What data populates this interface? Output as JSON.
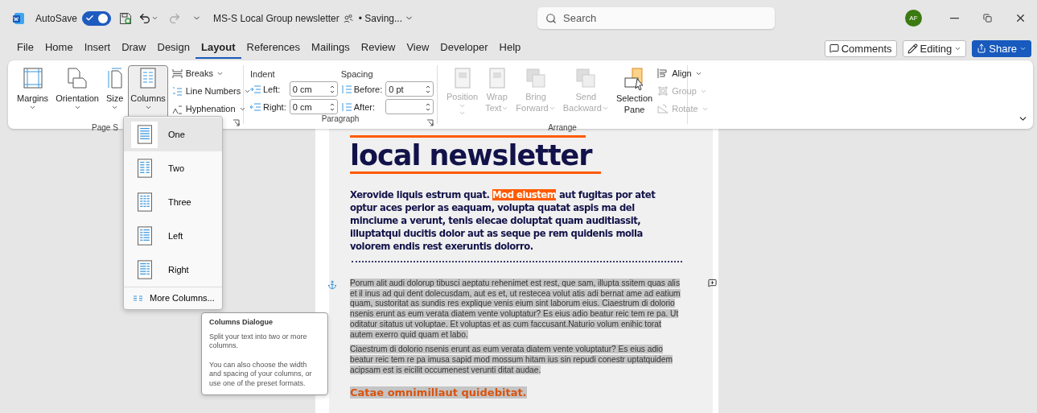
{
  "title_bar": {
    "autosave_label": "AutoSave",
    "autosave_on": true,
    "doc_title": "MS-S Local Group newsletter",
    "status": "• Saving...",
    "search": {
      "placeholder": "Search"
    },
    "avatar": "AF"
  },
  "menu_tabs": [
    {
      "label": "File",
      "selected": false
    },
    {
      "label": "Home",
      "selected": false
    },
    {
      "label": "Insert",
      "selected": false
    },
    {
      "label": "Draw",
      "selected": false
    },
    {
      "label": "Design",
      "selected": false
    },
    {
      "label": "Layout",
      "selected": true
    },
    {
      "label": "References",
      "selected": false
    },
    {
      "label": "Mailings",
      "selected": false
    },
    {
      "label": "Review",
      "selected": false
    },
    {
      "label": "View",
      "selected": false
    },
    {
      "label": "Developer",
      "selected": false
    },
    {
      "label": "Help",
      "selected": false
    }
  ],
  "header_buttons": {
    "comments": "Comments",
    "editing": "Editing",
    "share": "Share"
  },
  "ribbon": {
    "page_setup": {
      "label": "Page S",
      "buttons": [
        {
          "label": "Margins",
          "pressed": false
        },
        {
          "label": "Orientation",
          "pressed": false
        },
        {
          "label": "Size",
          "pressed": false
        },
        {
          "label": "Columns",
          "pressed": true
        }
      ],
      "small_buttons": [
        "Breaks",
        "Line Numbers",
        "Hyphenation"
      ]
    },
    "paragraph": {
      "label": "Paragraph",
      "indent_label": "Indent",
      "spacing_label": "Spacing",
      "left_label": "Left:",
      "left_value": "0 cm",
      "right_label": "Right:",
      "right_value": "0 cm",
      "before_label": "Before:",
      "before_value": "0 pt",
      "after_label": "After:"
    },
    "arrange": {
      "label": "Arrange",
      "buttons": [
        {
          "label": "Position",
          "disabled": true
        },
        {
          "label": "Wrap Text",
          "disabled": true
        },
        {
          "label": "Bring Forward",
          "disabled": true
        },
        {
          "label": "Send Backward",
          "disabled": true
        },
        {
          "label": "Selection Pane",
          "disabled": false
        }
      ],
      "small_buttons": [
        {
          "label": "Align",
          "disabled": false
        },
        {
          "label": "Group",
          "disabled": true
        },
        {
          "label": "Rotate",
          "disabled": true
        }
      ]
    }
  },
  "columns_menu": {
    "items": [
      {
        "label": "One",
        "selected": true
      },
      {
        "label": "Two",
        "selected": false
      },
      {
        "label": "Three",
        "selected": false
      },
      {
        "label": "Left",
        "selected": false
      },
      {
        "label": "Right",
        "selected": false
      }
    ],
    "more": "More Columns..."
  },
  "tooltip": {
    "title": "Columns Dialogue",
    "text": "Split your text into two or more columns.",
    "text_2": "You can also choose the width and spacing of your columns, or use one of the preset formats."
  },
  "document": {
    "heading": "local newsletter",
    "lead": [
      {
        "text": "Xerovide liquis estrum quat. ",
        "highlight": false
      },
      {
        "text": "Mod eiustem",
        "highlight": true
      },
      {
        "text": " aut fugitas por atet optur aces perior as eaquam, volupta quatat aspis ma del minciume a verunt, tenis elecae doluptat quam auditiassit, illuptatqui ducitis dolor aut as seque pe rem quidenis molla volorem endis rest exeruntis dolorro.",
        "highlight": false
      }
    ],
    "paragraphs": [
      {
        "text": "Porum alit audi dolorup tibusci aeptatu rehenimet est rest, que sam, illupta ssitem quas alis et il inus ad qui dent dolecusdam, aut es et, ut restecea volut atis adi bernat ame ad eatium quam, sustoritat as sundis res explique venis eium sint laborum eius. Ciaestrum di dolorio nsenis erunt as eum verata diatem vente voluptatur? Es eius adio beatur reic tem re pa. Ut oditatur sitatus ut voluptae. Et voluptas et as cum faccusant.Naturio volum enihic torat autem exerro quid quam et labo.",
        "selected": true
      },
      {
        "text": "Ciaestrum di dolorio nsenis erunt as eum verata diatem vente voluptatur? Es eius adio beatur reic tem re pa imusa sapid mod mossum hitam ius sin repudi conestr uptatquidem acipsam est is eicilit occumenest verunti ditat audae.",
        "selected": true
      }
    ],
    "subheading": {
      "text": "Catae omnimillaut quidebitat.",
      "selected": true
    }
  }
}
